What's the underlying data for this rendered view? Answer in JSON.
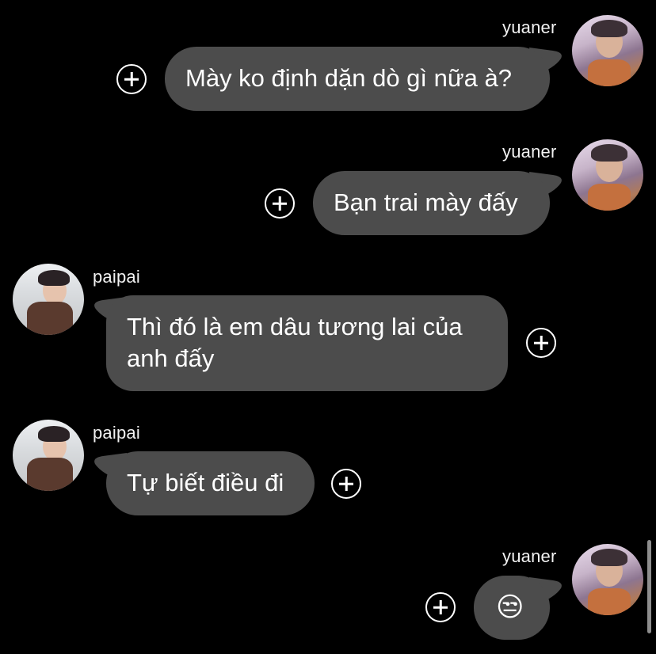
{
  "conversation": {
    "messages": [
      {
        "sender": "yuaner",
        "text": "Mày ko định dặn dò gì nữa à?"
      },
      {
        "sender": "yuaner",
        "text": "Bạn trai mày đấy"
      },
      {
        "sender": "paipai",
        "text": "Thì đó là em dâu tương lai của anh đấy"
      },
      {
        "sender": "paipai",
        "text": "Tự biết điều đi"
      },
      {
        "sender": "yuaner",
        "text": "😒"
      }
    ]
  },
  "icons": {
    "add_reaction": "plus-circle-icon"
  },
  "colors": {
    "background": "#000000",
    "bubble": "#4c4c4c",
    "text": "#ffffff"
  }
}
